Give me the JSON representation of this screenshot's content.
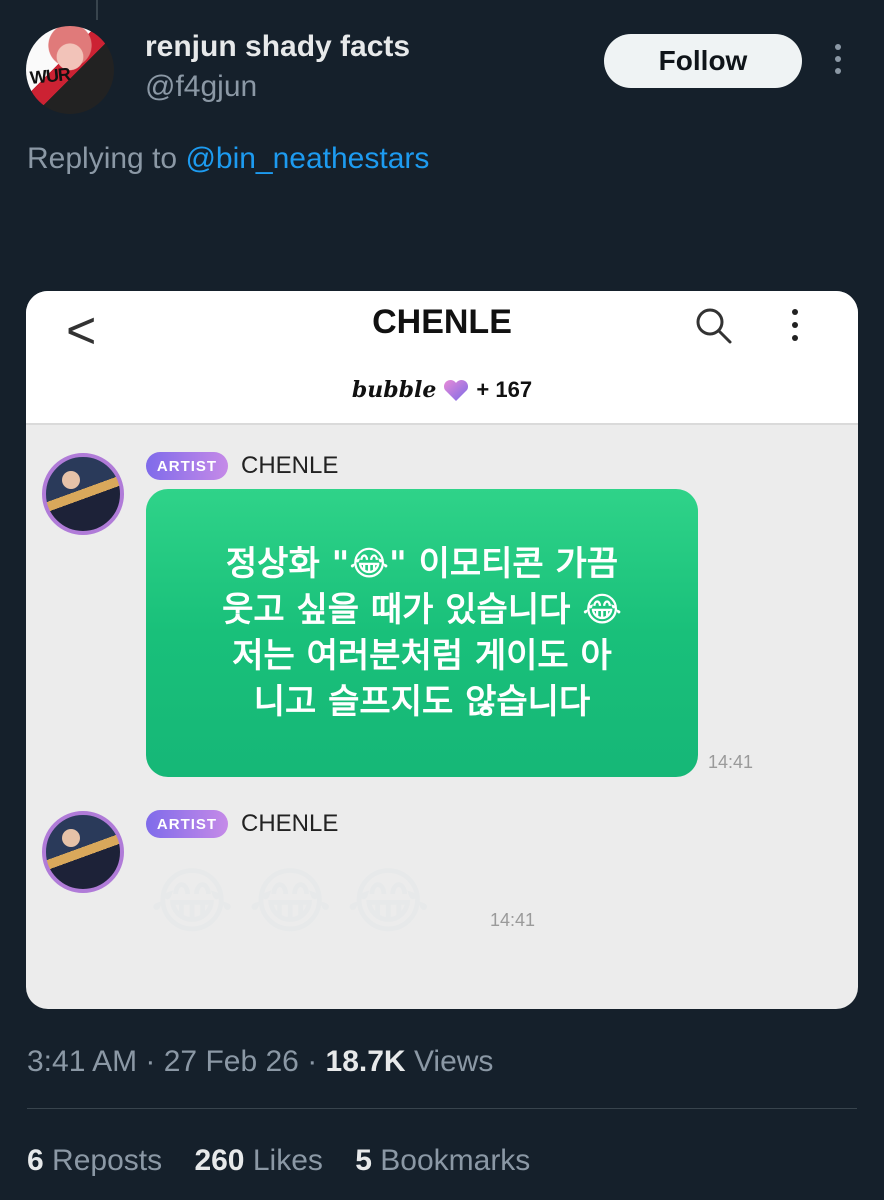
{
  "tweet": {
    "display_name": "renjun shady facts",
    "handle": "@f4gjun",
    "follow_label": "Follow",
    "replying_prefix": "Replying to ",
    "replying_to": "@bin_neathestars",
    "avatar_text": "WUR",
    "time": "3:41 AM",
    "date": "27 Feb 26",
    "views_count": "18.7K",
    "views_label": "Views",
    "reposts_count": "6",
    "reposts_label": "Reposts",
    "likes_count": "260",
    "likes_label": "Likes",
    "bookmarks_count": "5",
    "bookmarks_label": "Bookmarks"
  },
  "screenshot": {
    "title": "CHENLE",
    "back_glyph": "<",
    "bubble_word": "bubble",
    "bubble_count": "+ 167",
    "messages": [
      {
        "badge": "ARTIST",
        "sender": "CHENLE",
        "line1": "정상화 \"😂\" 이모티콘 가끔",
        "line2": "웃고 싶을 때가 있습니다 😂",
        "line3": "저는 여러분처럼 게이도 아",
        "line4": "니고 슬프지도 않습니다",
        "time": "14:41"
      },
      {
        "badge": "ARTIST",
        "sender": "CHENLE",
        "emojis": [
          "😂",
          "😂",
          "😂"
        ],
        "time": "14:41"
      }
    ]
  },
  "colors": {
    "background": "#15202b",
    "accent": "#1d9bf0",
    "bubble_green": "#19c07a",
    "artist_badge": "#9b78e8"
  }
}
